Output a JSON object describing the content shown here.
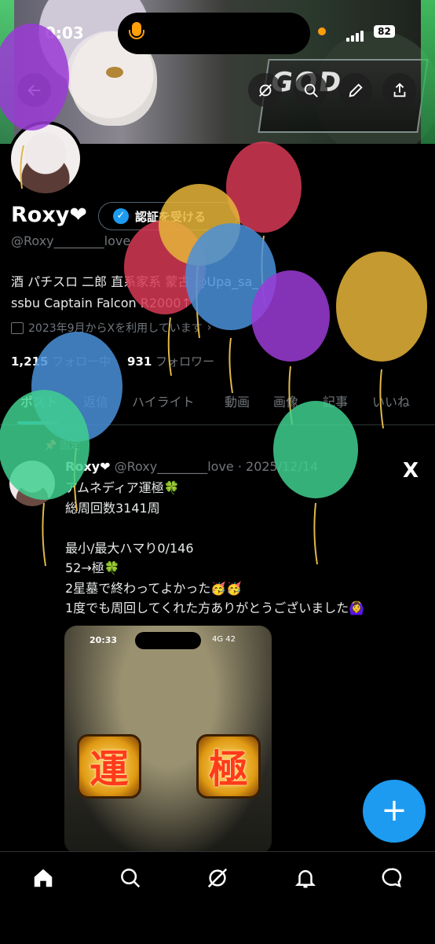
{
  "status_bar": {
    "time": "0:03",
    "battery": "82"
  },
  "profile": {
    "name": "Roxy❤",
    "verify_button": "認証を受ける",
    "handle": "@Roxy________love",
    "bio_line1": "酒 パチスロ 二郎 直系家系 蒙古 @Upa_sa_",
    "bio_line2": "ssbu Captain Falcon R2000↑",
    "joined": "2023年9月からXを利用しています",
    "following_count": "1,215",
    "following_label": "フォロー中",
    "followers_count": "931",
    "followers_label": "フォロワー"
  },
  "tabs": [
    "ポスト",
    "返信",
    "ハイライト",
    "動画",
    "画像",
    "記事",
    "いいね"
  ],
  "pinned_label": "固定",
  "post": {
    "author": "Roxy❤",
    "handle": "@Roxy________love",
    "date": "· 2025/12/14",
    "lines": [
      "アムネディア運極🍀",
      "総周回数3141周",
      "",
      "最小/最大ハマり0/146",
      "52→極🍀",
      "2星墓で終わってよかった🥳🥳",
      "1度でも周回してくれた方ありがとうございました🙆‍♀️"
    ],
    "media": {
      "time": "20:33",
      "status": "4G 42",
      "kanji_left": "運",
      "kanji_right": "極"
    }
  },
  "banner": {
    "logo_text": "GOD"
  },
  "fab_label": "+",
  "x_logo": "X",
  "colors": {
    "accent": "#1d9bf0",
    "background": "#000000",
    "muted": "#71767b"
  }
}
